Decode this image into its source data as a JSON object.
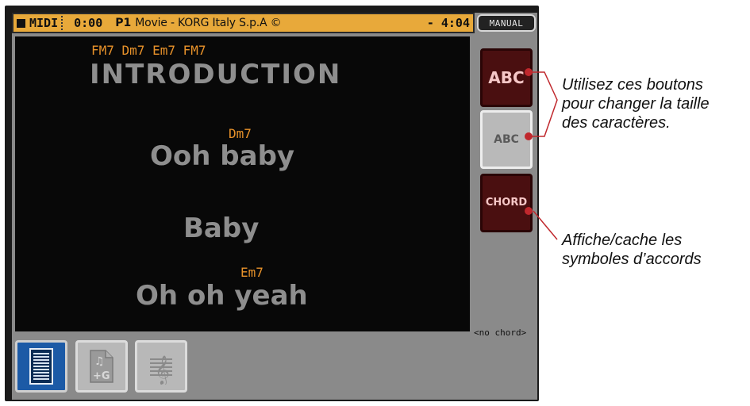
{
  "status_bar": {
    "mode": "MIDI",
    "time": "0:00",
    "track": "P1",
    "title": "Movie - KORG Italy S.p.A ©",
    "remaining": "- 4:04"
  },
  "manual_button": "MANUAL",
  "lyrics": [
    {
      "chords": "FM7 Dm7 Em7 FM7",
      "text": "INTRODUCTION"
    },
    {
      "chords": "Dm7",
      "text": "Ooh baby"
    },
    {
      "chords": "",
      "text": "Baby"
    },
    {
      "chords": "Em7",
      "text": "Oh oh yeah"
    }
  ],
  "side_buttons": {
    "big_text": "ABC",
    "small_text": "ABC",
    "chord": "CHORD"
  },
  "chord_display": "<no chord>",
  "tabs": [
    {
      "name": "lyrics",
      "icon": "lyrics-page-icon",
      "selected": true
    },
    {
      "name": "score",
      "icon": "music-file-g-icon",
      "selected": false
    },
    {
      "name": "staff",
      "icon": "treble-clef-staff-icon",
      "selected": false
    }
  ],
  "annotations": {
    "text_size": "Utilisez ces boutons\npour changer la taille\ndes caractères.",
    "chords": "Affiche/cache les\nsymboles d’accords"
  },
  "colors": {
    "status_bar": "#e8a93a",
    "chord_text": "#e8922a",
    "lyric_text": "#8e8e8e",
    "button_dark_red": "#4a0f10",
    "tab_selected": "#1c5aa6",
    "annotation_line": "#c0282d"
  }
}
